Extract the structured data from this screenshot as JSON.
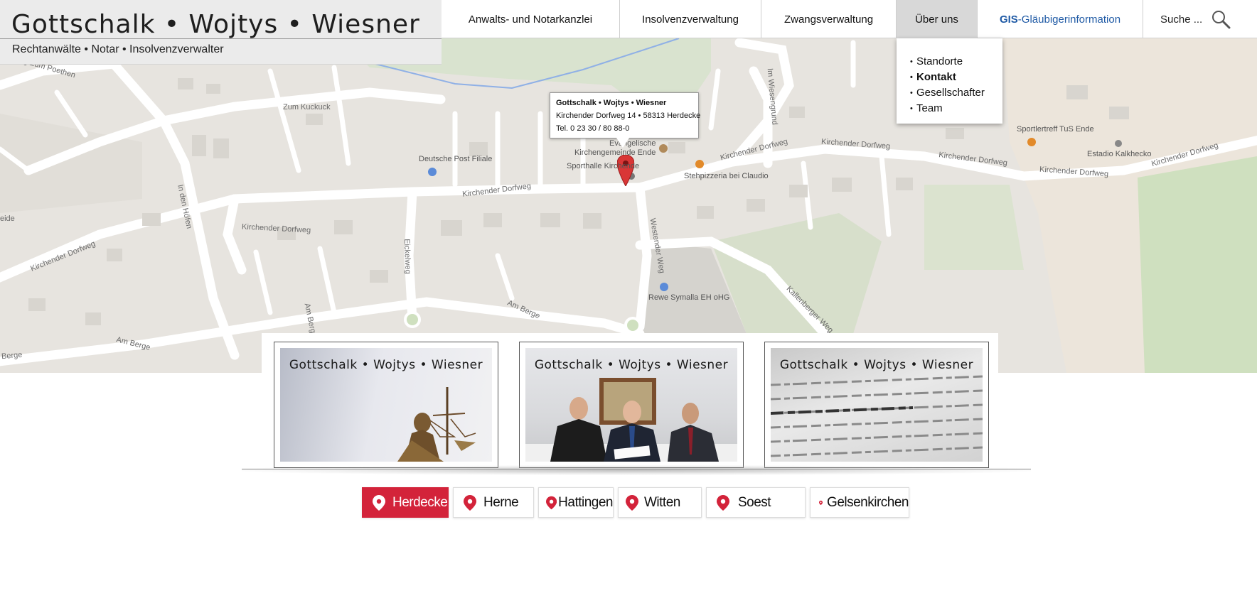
{
  "header": {
    "logo_title": "Gottschalk • Wojtys • Wiesner",
    "logo_subtitle": "Rechtanwälte • Notar • Insolvenzverwalter"
  },
  "nav": {
    "items": [
      {
        "label": "Anwalts- und Notarkanzlei"
      },
      {
        "label": "Insolvenzverwaltung"
      },
      {
        "label": "Zwangsverwaltung"
      },
      {
        "label": "Über uns"
      }
    ],
    "gis_strong": "GIS",
    "gis_rest": "-Gläubigerinformation",
    "search_label": "Suche ..."
  },
  "dropdown": {
    "items": [
      {
        "label": "Standorte"
      },
      {
        "label": "Kontakt"
      },
      {
        "label": "Gesellschafter"
      },
      {
        "label": "Team"
      }
    ]
  },
  "map": {
    "bubble": {
      "name": "Gottschalk • Wojtys • Wiesner",
      "address": "Kirchender Dorfweg 14 • 58313 Herdecke",
      "phone": "Tel. 0 23 30 / 80 88-0"
    },
    "labels": {
      "zum_kuckuck": "Zum Kuckuck",
      "zum_poethen": "Weg Zum Poethen",
      "deutsche_post": "Deutsche Post Filiale",
      "kirche_1": "Evangelische",
      "kirche_2": "Kirchengemeinde Ende",
      "sporthalle": "Sporthalle Kirchende",
      "stehpizzeria": "Stehpizzeria bei Claudio",
      "sportlertreff": "Sportlertreff TuS Ende",
      "estadio": "Estadio Kalkhecko",
      "rewe": "Rewe Symalla EH oHG",
      "kd1": "Kirchender Dorfweg",
      "kd2": "Kirchender Dorfweg",
      "kd3": "Kirchender Dorfweg",
      "kd4": "Kirchender Dorfweg",
      "kd5": "Kirchender Dorfweg",
      "kd6": "Kirchender Dorfweg",
      "kd7": "Kirchender Dorfweg",
      "kd8": "Kirchender Dorfweg",
      "in_den_hoefen": "In den Höfen",
      "eickelweg": "Eickelweg",
      "westender_weg": "Westender Weg",
      "am_berge1": "Am Berge",
      "am_berge2": "Am Berge",
      "am_berge3": "Am Berge",
      "am_berge4": "Berge",
      "im_wiesengrund": "Im Wiesengrund",
      "kallenberger": "Kallenberger Weg",
      "weide": "eide"
    }
  },
  "cards": [
    {
      "title": "Gottschalk • Wojtys • Wiesner",
      "image": "justitia-statue"
    },
    {
      "title": "Gottschalk • Wojtys • Wiesner",
      "image": "lawyers-meeting"
    },
    {
      "title": "Gottschalk • Wojtys • Wiesner",
      "image": "law-book-text"
    }
  ],
  "locations": [
    {
      "label": "Herdecke",
      "active": true
    },
    {
      "label": "Herne"
    },
    {
      "label": "Hattingen"
    },
    {
      "label": "Witten"
    },
    {
      "label": "Soest"
    },
    {
      "label": "Gelsenkirchen"
    }
  ],
  "colors": {
    "accent_red": "#d3233a",
    "gis_blue": "#1f5aa5",
    "map_bg": "#e7e4df"
  }
}
